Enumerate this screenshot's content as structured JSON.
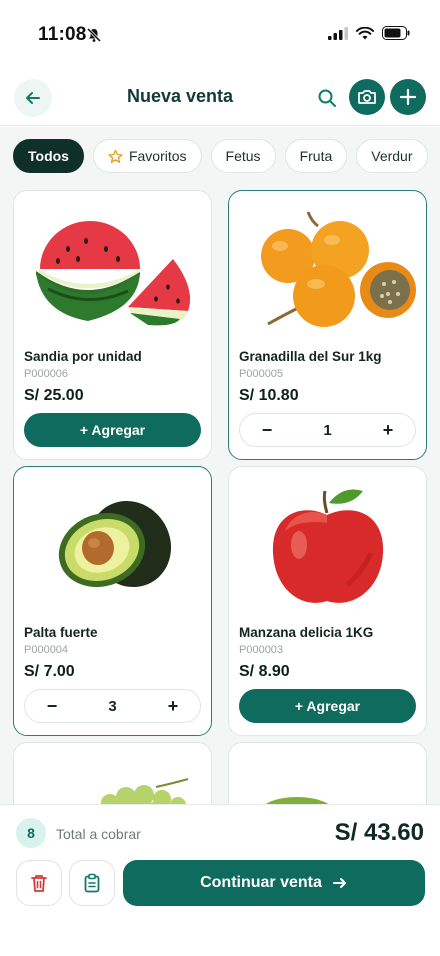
{
  "status_bar": {
    "time": "11:08"
  },
  "header": {
    "title": "Nueva venta"
  },
  "chips": [
    {
      "label": "Todos",
      "active": true
    },
    {
      "label": "Favoritos",
      "active": false
    },
    {
      "label": "Fetus",
      "active": false
    },
    {
      "label": "Fruta",
      "active": false
    },
    {
      "label": "Verdur",
      "active": false
    }
  ],
  "products": [
    {
      "name": "Sandia por unidad",
      "code": "P000006",
      "price": "S/ 25.00",
      "action": "+ Agregar",
      "icon": "watermelon-image"
    },
    {
      "name": "Granadilla del Sur 1kg",
      "code": "P000005",
      "price": "S/ 10.80",
      "quantity": "1",
      "icon": "granadilla-image"
    },
    {
      "name": "Palta fuerte",
      "code": "P000004",
      "price": "S/ 7.00",
      "quantity": "3",
      "icon": "avocado-image"
    },
    {
      "name": "Manzana delicia 1KG",
      "code": "P000003",
      "price": "S/ 8.90",
      "action": "+ Agregar",
      "icon": "apple-image"
    }
  ],
  "stepper": {
    "minus": "−",
    "plus": "+"
  },
  "footer": {
    "item_count": "8",
    "total_label": "Total a cobrar",
    "total_amount": "S/ 43.60",
    "continue_label": "Continuar venta"
  },
  "colors": {
    "primary": "#0f6b5e",
    "dark": "#0f2f29",
    "accent_light": "#d8f2ee",
    "danger": "#d23b3b"
  }
}
